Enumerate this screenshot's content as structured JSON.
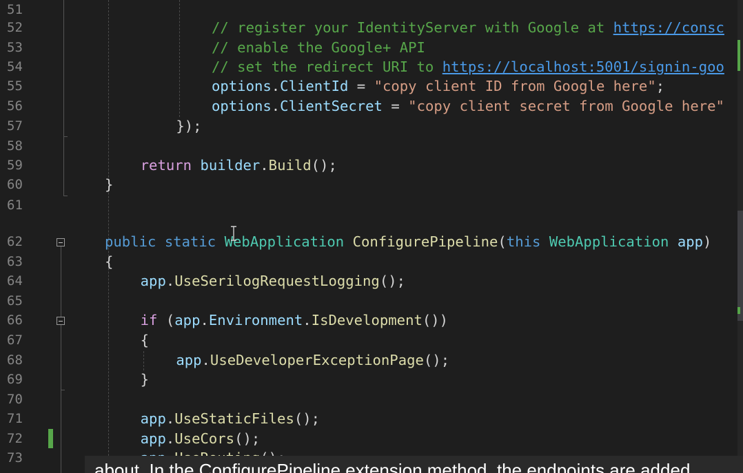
{
  "editor": {
    "lines": [
      {
        "num": "51",
        "indent": 0,
        "segments": []
      },
      {
        "num": "52",
        "indent": 6,
        "segments": [
          {
            "c": "cm",
            "t": "// register your IdentityServer with Google at "
          },
          {
            "c": "link",
            "t": "https://consc"
          }
        ]
      },
      {
        "num": "53",
        "indent": 6,
        "segments": [
          {
            "c": "cm",
            "t": "// enable the Google+ API"
          }
        ]
      },
      {
        "num": "54",
        "indent": 6,
        "segments": [
          {
            "c": "cm",
            "t": "// set the redirect URI to "
          },
          {
            "c": "link",
            "t": "https://localhost:5001/signin-goo"
          }
        ]
      },
      {
        "num": "55",
        "indent": 6,
        "segments": [
          {
            "c": "id",
            "t": "options"
          },
          {
            "c": "p",
            "t": "."
          },
          {
            "c": "id",
            "t": "ClientId"
          },
          {
            "c": "p",
            "t": " = "
          },
          {
            "c": "s",
            "t": "\"copy client ID from Google here\""
          },
          {
            "c": "p",
            "t": ";"
          }
        ]
      },
      {
        "num": "56",
        "indent": 6,
        "segments": [
          {
            "c": "id",
            "t": "options"
          },
          {
            "c": "p",
            "t": "."
          },
          {
            "c": "id",
            "t": "ClientSecret"
          },
          {
            "c": "p",
            "t": " = "
          },
          {
            "c": "s",
            "t": "\"copy client secret from Google here\""
          }
        ]
      },
      {
        "num": "57",
        "indent": 4,
        "segments": [
          {
            "c": "p",
            "t": "});"
          }
        ]
      },
      {
        "num": "58",
        "indent": 0,
        "segments": []
      },
      {
        "num": "59",
        "indent": 2,
        "segments": [
          {
            "c": "kc",
            "t": "return"
          },
          {
            "c": "p",
            "t": " "
          },
          {
            "c": "id",
            "t": "builder"
          },
          {
            "c": "p",
            "t": "."
          },
          {
            "c": "m",
            "t": "Build"
          },
          {
            "c": "p",
            "t": "();"
          }
        ]
      },
      {
        "num": "60",
        "indent": 0,
        "segments": [
          {
            "c": "p",
            "t": "}"
          }
        ]
      },
      {
        "num": "61",
        "indent": 0,
        "segments": []
      },
      {
        "num": "62",
        "indent": 0,
        "segments": [
          {
            "c": "k",
            "t": "public"
          },
          {
            "c": "p",
            "t": " "
          },
          {
            "c": "k",
            "t": "static"
          },
          {
            "c": "p",
            "t": " "
          },
          {
            "c": "t",
            "t": "WebApplication"
          },
          {
            "c": "p",
            "t": " "
          },
          {
            "c": "m",
            "t": "ConfigurePipeline"
          },
          {
            "c": "p",
            "t": "("
          },
          {
            "c": "k",
            "t": "this"
          },
          {
            "c": "p",
            "t": " "
          },
          {
            "c": "t",
            "t": "WebApplication"
          },
          {
            "c": "p",
            "t": " "
          },
          {
            "c": "id",
            "t": "app"
          },
          {
            "c": "p",
            "t": ")"
          }
        ]
      },
      {
        "num": "63",
        "indent": 0,
        "segments": [
          {
            "c": "p",
            "t": "{"
          }
        ]
      },
      {
        "num": "64",
        "indent": 2,
        "segments": [
          {
            "c": "id",
            "t": "app"
          },
          {
            "c": "p",
            "t": "."
          },
          {
            "c": "m",
            "t": "UseSerilogRequestLogging"
          },
          {
            "c": "p",
            "t": "();"
          }
        ]
      },
      {
        "num": "65",
        "indent": 0,
        "segments": []
      },
      {
        "num": "66",
        "indent": 2,
        "segments": [
          {
            "c": "kc",
            "t": "if"
          },
          {
            "c": "p",
            "t": " ("
          },
          {
            "c": "id",
            "t": "app"
          },
          {
            "c": "p",
            "t": "."
          },
          {
            "c": "id",
            "t": "Environment"
          },
          {
            "c": "p",
            "t": "."
          },
          {
            "c": "m",
            "t": "IsDevelopment"
          },
          {
            "c": "p",
            "t": "())"
          }
        ]
      },
      {
        "num": "67",
        "indent": 2,
        "segments": [
          {
            "c": "p",
            "t": "{"
          }
        ]
      },
      {
        "num": "68",
        "indent": 4,
        "segments": [
          {
            "c": "id",
            "t": "app"
          },
          {
            "c": "p",
            "t": "."
          },
          {
            "c": "m",
            "t": "UseDeveloperExceptionPage"
          },
          {
            "c": "p",
            "t": "();"
          }
        ]
      },
      {
        "num": "69",
        "indent": 2,
        "segments": [
          {
            "c": "p",
            "t": "}"
          }
        ]
      },
      {
        "num": "70",
        "indent": 0,
        "segments": []
      },
      {
        "num": "71",
        "indent": 2,
        "segments": [
          {
            "c": "id",
            "t": "app"
          },
          {
            "c": "p",
            "t": "."
          },
          {
            "c": "m",
            "t": "UseStaticFiles"
          },
          {
            "c": "p",
            "t": "();"
          }
        ]
      },
      {
        "num": "72",
        "indent": 2,
        "segments": [
          {
            "c": "id",
            "t": "app"
          },
          {
            "c": "p",
            "t": "."
          },
          {
            "c": "m",
            "t": "UseCors"
          },
          {
            "c": "p",
            "t": "();"
          }
        ]
      },
      {
        "num": "73",
        "indent": 2,
        "segments": [
          {
            "c": "id",
            "t": "app"
          },
          {
            "c": "p",
            "t": "."
          },
          {
            "c": "m",
            "t": "UseRouting"
          },
          {
            "c": "p",
            "t": "();"
          }
        ]
      }
    ]
  },
  "caption": {
    "text": "about. In the ConfigurePipeline extension method, the endpoints are added"
  },
  "colors": {
    "background": "#1e1e1e",
    "comment": "#57a64a",
    "link": "#4a9ae8",
    "identifier": "#9cdcfe",
    "method": "#dcdcaa",
    "string": "#d69d85",
    "keyword": "#569cd6",
    "control_keyword": "#d8a0df",
    "type": "#4ec9b0",
    "change_marker": "#57a64a"
  },
  "icons": {
    "fold_toggle": "collapse-minus-icon",
    "mouse_cursor": "text-ibeam-cursor-icon"
  }
}
